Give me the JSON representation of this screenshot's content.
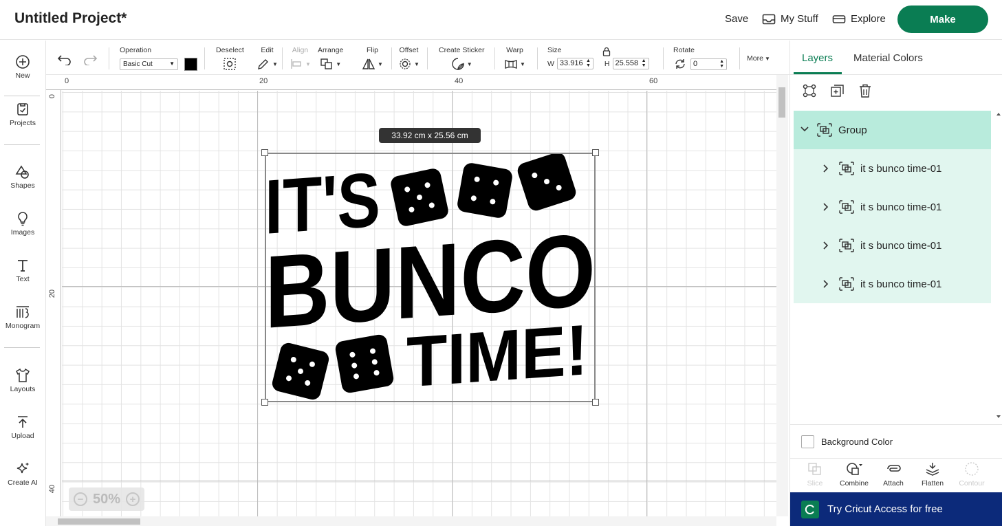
{
  "header": {
    "project_title": "Untitled Project*",
    "save_label": "Save",
    "my_stuff_label": "My Stuff",
    "explore_label": "Explore",
    "make_label": "Make",
    "make_color": "#0a7d53"
  },
  "sidebar": {
    "items": [
      {
        "label": "New",
        "icon": "plus-circle-icon"
      },
      {
        "label": "Projects",
        "icon": "projects-icon"
      },
      {
        "label": "Shapes",
        "icon": "shapes-icon"
      },
      {
        "label": "Images",
        "icon": "lightbulb-icon"
      },
      {
        "label": "Text",
        "icon": "text-icon"
      },
      {
        "label": "Monogram",
        "icon": "monogram-icon"
      },
      {
        "label": "Layouts",
        "icon": "shirt-icon"
      },
      {
        "label": "Upload",
        "icon": "upload-icon"
      },
      {
        "label": "Create AI",
        "icon": "sparkle-icon"
      }
    ]
  },
  "toolbar": {
    "operation_label": "Operation",
    "operation_value": "Basic Cut",
    "deselect_label": "Deselect",
    "edit_label": "Edit",
    "align_label": "Align",
    "arrange_label": "Arrange",
    "flip_label": "Flip",
    "offset_label": "Offset",
    "create_sticker_label": "Create Sticker",
    "warp_label": "Warp",
    "size_label": "Size",
    "width_prefix": "W",
    "width_value": "33.916",
    "height_prefix": "H",
    "height_value": "25.558",
    "rotate_label": "Rotate",
    "rotate_value": "0",
    "more_label": "More"
  },
  "canvas": {
    "ruler_top": [
      "0",
      "20",
      "40",
      "60"
    ],
    "ruler_left": [
      "0",
      "20",
      "40"
    ],
    "dimension_tooltip": "33.92  cm x 25.56  cm",
    "zoom_value": "50%",
    "artwork_lines": [
      "IT'S",
      "BUNCO",
      "TIME!"
    ]
  },
  "panel": {
    "tabs": [
      "Layers",
      "Material Colors"
    ],
    "group_label": "Group",
    "layers": [
      {
        "label": "it s bunco time-01"
      },
      {
        "label": "it s bunco time-01"
      },
      {
        "label": "it s bunco time-01"
      },
      {
        "label": "it s bunco time-01"
      }
    ],
    "background_color_label": "Background Color",
    "bottom_tools": [
      {
        "label": "Slice",
        "enabled": false
      },
      {
        "label": "Combine",
        "enabled": true
      },
      {
        "label": "Attach",
        "enabled": true
      },
      {
        "label": "Flatten",
        "enabled": true
      },
      {
        "label": "Contour",
        "enabled": false
      }
    ],
    "access_label": "Try Cricut Access for free",
    "access_color": "#0c2a7a"
  }
}
